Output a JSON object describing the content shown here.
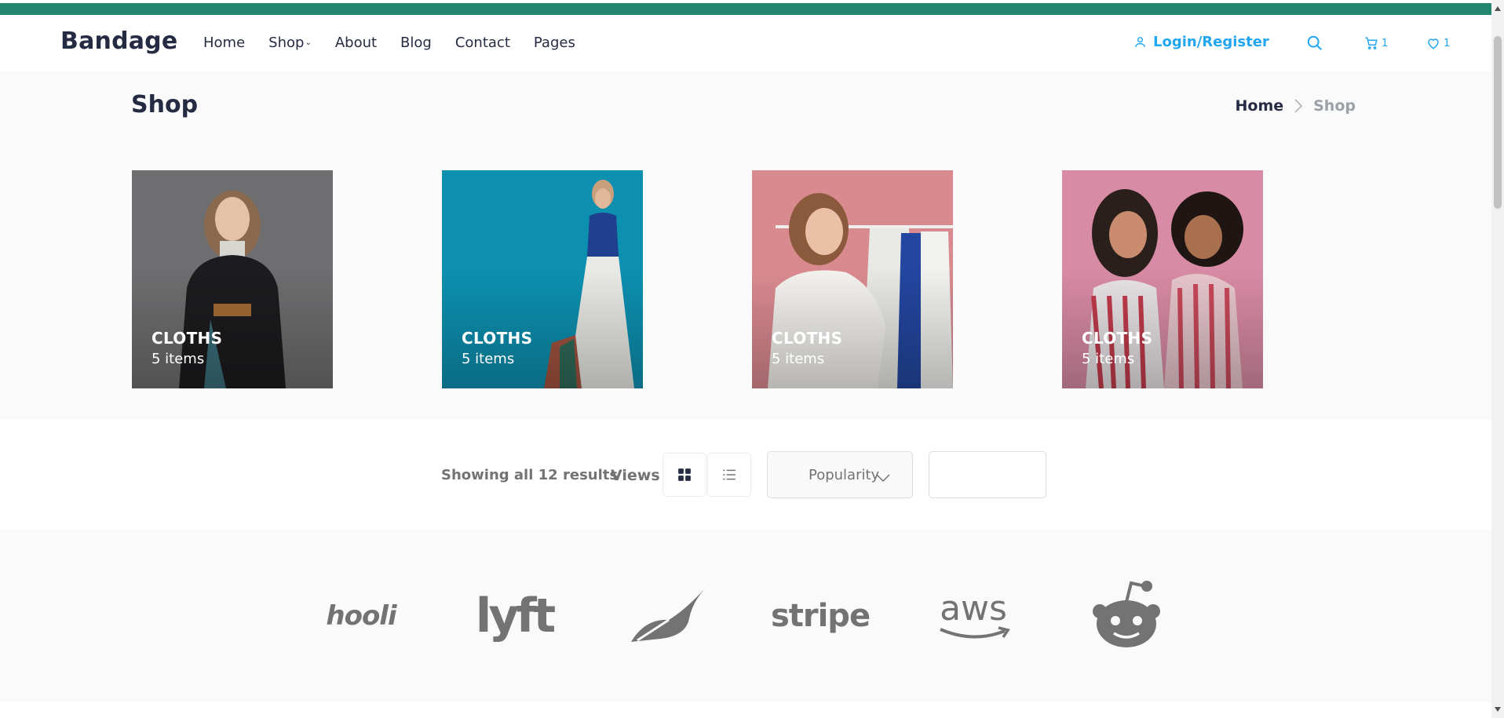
{
  "nav": {
    "brand": "Bandage",
    "links": [
      {
        "label": "Home"
      },
      {
        "label": "Shop"
      },
      {
        "label": "About"
      },
      {
        "label": "Blog"
      },
      {
        "label": "Contact"
      },
      {
        "label": "Pages"
      }
    ],
    "login_label": "Login/Register",
    "cart_count": "1",
    "wishlist_count": "1"
  },
  "header": {
    "title": "Shop",
    "breadcrumb": {
      "home": "Home",
      "current": "Shop"
    }
  },
  "categories": [
    {
      "title": "CLOTHS",
      "count": "5 items",
      "bg": "#6b6b6b"
    },
    {
      "title": "CLOTHS",
      "count": "5 items",
      "bg": "#0b91b3"
    },
    {
      "title": "CLOTHS",
      "count": "5 items",
      "bg": "#d9878d"
    },
    {
      "title": "CLOTHS",
      "count": "5 items",
      "bg": "#d98aa3"
    }
  ],
  "filters": {
    "results_text": "Showing all 12 results",
    "views_label": "Views",
    "sort_label": "Popularity"
  },
  "clients": [
    {
      "name": "hooli"
    },
    {
      "name": "lyft"
    },
    {
      "name": "leaf-logo",
      "label": ""
    },
    {
      "name": "stripe"
    },
    {
      "name": "aws"
    },
    {
      "name": "reddit-logo",
      "label": ""
    }
  ],
  "colors": {
    "accent": "#23a6f0",
    "topbar": "#23856d",
    "heading": "#252b42",
    "muted": "#737373"
  }
}
